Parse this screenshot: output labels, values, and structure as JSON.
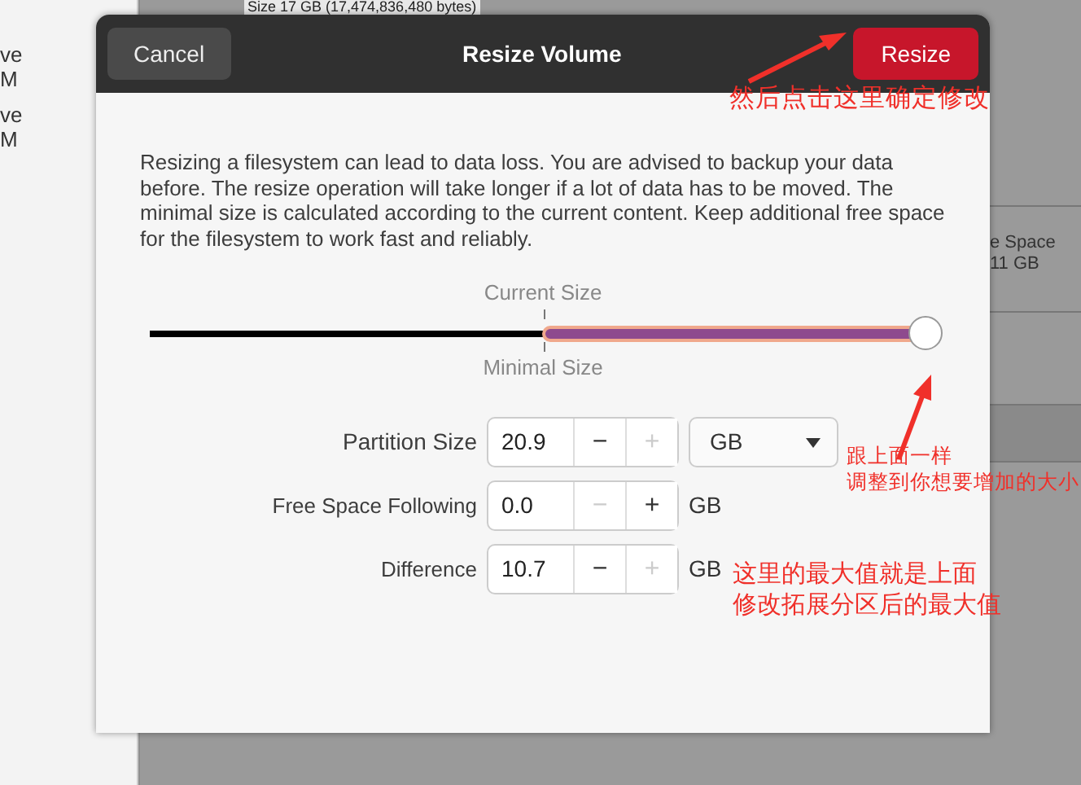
{
  "background_app": {
    "header_text": "Size 17 GB (17,474,836,480 bytes)",
    "sidebar_texts": [
      "ve",
      "M",
      "ve",
      "M"
    ],
    "side_panel_texts": [
      "e Space",
      "11 GB"
    ]
  },
  "dialog": {
    "title": "Resize Volume",
    "cancel_button": "Cancel",
    "resize_button": "Resize",
    "description": "Resizing a filesystem can lead to data loss. You are advised to backup your data before. The resize operation will take longer if a lot of data has to be moved. The minimal size is calculated according to the current content. Keep additional free space for the filesystem to work fast and reliably.",
    "slider": {
      "current_label": "Current Size",
      "minimal_label": "Minimal Size",
      "level": 1
    },
    "fields": [
      {
        "label": "Partition Size",
        "value": "20.9",
        "minus": "−",
        "plus": "+",
        "minus_disabled": false,
        "plus_disabled": true,
        "kind": "dropdown",
        "unit": "GB"
      },
      {
        "label": "Free Space Following",
        "value": "0.0",
        "minus": "−",
        "plus": "+",
        "minus_disabled": true,
        "plus_disabled": false,
        "kind": "text",
        "unit": "GB"
      },
      {
        "label": "Difference",
        "value": "10.7",
        "minus": "−",
        "plus": "+",
        "minus_disabled": false,
        "plus_disabled": true,
        "kind": "text",
        "unit": "GB"
      }
    ]
  },
  "annotations": [
    {
      "lines": [
        "然后点击这里确定修改"
      ]
    },
    {
      "lines": [
        "跟上面一样",
        "调整到你想要增加的大小"
      ]
    },
    {
      "lines": [
        "这里的最大值就是上面",
        "修改拓展分区后的最大值"
      ]
    }
  ]
}
